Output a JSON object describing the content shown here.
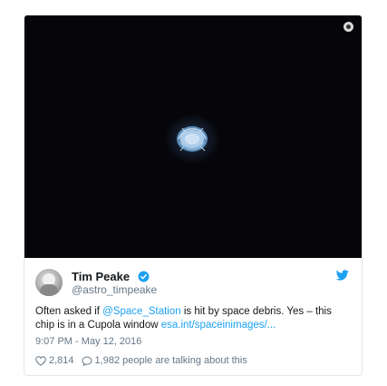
{
  "tweet": {
    "author": {
      "display_name": "Tim Peake",
      "handle": "@astro_timpeake",
      "verified": true
    },
    "text": {
      "before_mention": "Often asked if ",
      "mention": "@Space_Station",
      "after_mention": " is hit by space debris. Yes – this chip is in a Cupola window ",
      "link": "esa.int/spaceinimages/..."
    },
    "timestamp": "9:07 PM - May 12, 2016",
    "stats": {
      "likes": "2,814",
      "talking": "1,982 people are talking about this"
    },
    "icons": {
      "brand": "twitter-bird-icon",
      "verified": "verified-badge-icon",
      "like": "heart-icon",
      "reply": "speech-bubble-icon",
      "media_info": "info-icon"
    },
    "colors": {
      "accent": "#1da1f2",
      "text": "#14171a",
      "muted": "#657786",
      "border": "#e1e8ed",
      "media_background": "#06060a"
    }
  }
}
